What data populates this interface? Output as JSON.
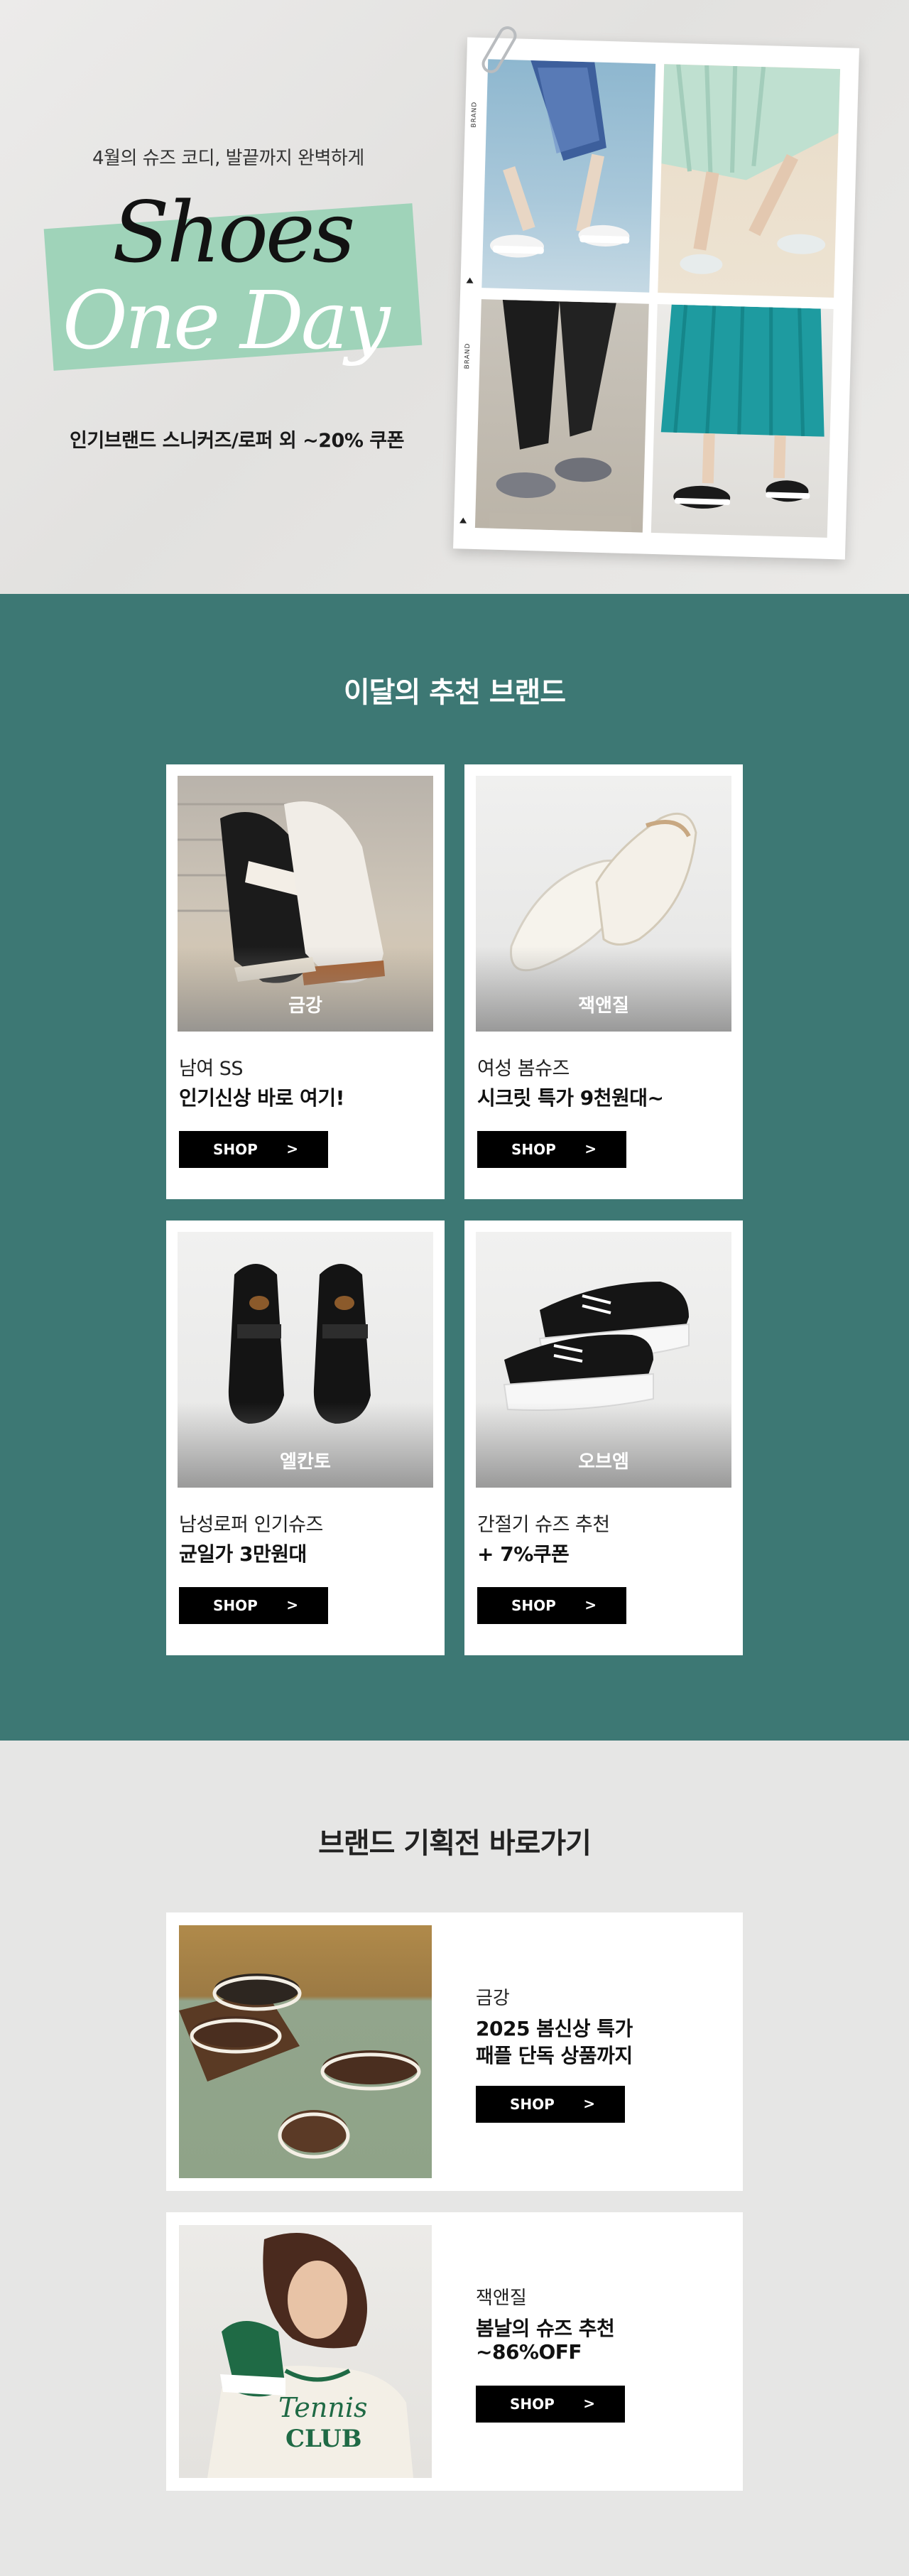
{
  "hero": {
    "subtitle": "4월의 슈즈 코디, 발끝까지 완벽하게",
    "title_line1": "Shoes",
    "title_line2": "One Day",
    "coupon": "인기브랜드 스니커즈/로퍼 외 ~20% 쿠폰",
    "tag_label": "BRAND"
  },
  "recommend": {
    "title": "이달의 추천 브랜드",
    "cards": [
      {
        "brand": "금강",
        "line1": "남여 SS",
        "line2": "인기신상 바로 여기!",
        "shop": "SHOP",
        "arrow": ">"
      },
      {
        "brand": "잭앤질",
        "line1": "여성 봄슈즈",
        "line2": "시크릿 특가 9천원대~",
        "shop": "SHOP",
        "arrow": ">"
      },
      {
        "brand": "엘칸토",
        "line1": "남성로퍼 인기슈즈",
        "line2": "균일가 3만원대",
        "shop": "SHOP",
        "arrow": ">"
      },
      {
        "brand": "오브엠",
        "line1": "간절기 슈즈 추천",
        "line2": "+ 7%쿠폰",
        "shop": "SHOP",
        "arrow": ">"
      }
    ]
  },
  "exhibits": {
    "title": "브랜드 기획전 바로가기",
    "items": [
      {
        "brand": "금강",
        "desc1": "2025 봄신상 특가",
        "desc2": "패플 단독 상품까지",
        "shop": "SHOP",
        "arrow": ">"
      },
      {
        "brand": "잭앤질",
        "desc1": "봄날의 슈즈 추천",
        "desc2": "~86%OFF",
        "shop": "SHOP",
        "arrow": ">",
        "shirt_text1": "Tennis",
        "shirt_text2": "CLUB"
      }
    ]
  },
  "colors": {
    "teal": "#3d7874",
    "mint": "#9fd3b9",
    "button": "#000000",
    "background": "#e6e6e5"
  }
}
